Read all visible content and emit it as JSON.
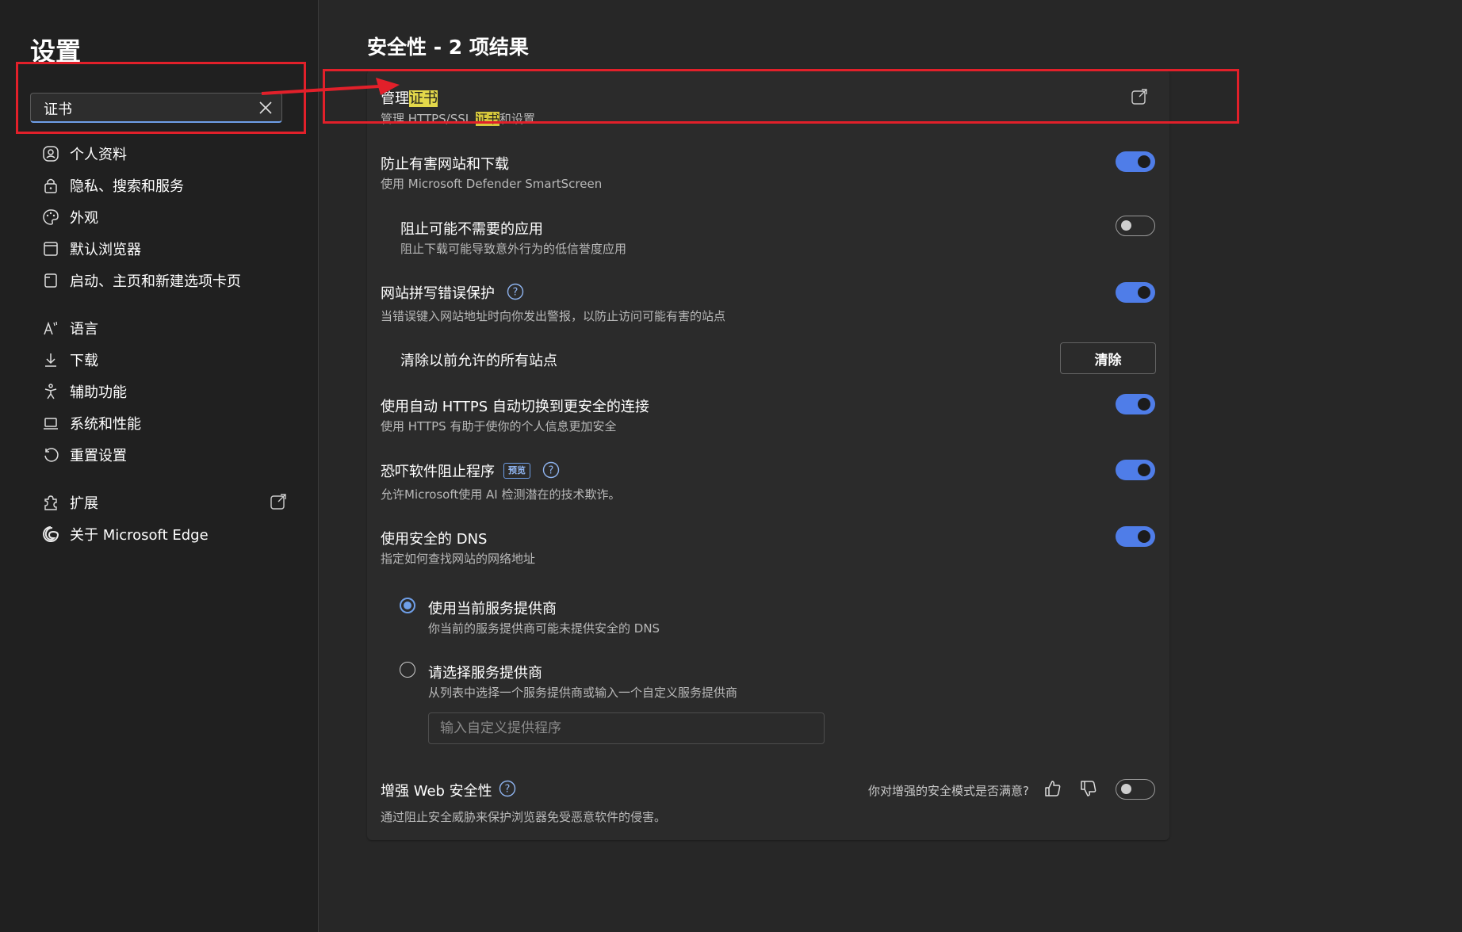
{
  "sidebar": {
    "title": "设置",
    "search": {
      "value": "证书",
      "placeholder": ""
    },
    "items": [
      {
        "label": "个人资料",
        "icon": "profile-icon"
      },
      {
        "label": "隐私、搜索和服务",
        "icon": "lock-icon"
      },
      {
        "label": "外观",
        "icon": "palette-icon"
      },
      {
        "label": "默认浏览器",
        "icon": "browser-icon"
      },
      {
        "label": "启动、主页和新建选项卡页",
        "icon": "home-page-icon"
      },
      {
        "label": "语言",
        "icon": "language-icon"
      },
      {
        "label": "下载",
        "icon": "download-icon"
      },
      {
        "label": "辅助功能",
        "icon": "accessibility-icon"
      },
      {
        "label": "系统和性能",
        "icon": "laptop-icon"
      },
      {
        "label": "重置设置",
        "icon": "reset-icon"
      },
      {
        "label": "扩展",
        "icon": "puzzle-icon"
      },
      {
        "label": "关于 Microsoft Edge",
        "icon": "edge-logo-icon"
      }
    ]
  },
  "main": {
    "title": "安全性 - 2 项结果",
    "manage_certs": {
      "title_prefix": "管理",
      "title_highlight": "证书",
      "sub_prefix": "管理 HTTPS/SSL ",
      "sub_highlight": "证书",
      "sub_suffix": "和设置"
    },
    "smartscreen": {
      "title": "防止有害网站和下载",
      "subtitle": "使用 Microsoft Defender SmartScreen",
      "on": true
    },
    "pua": {
      "title": "阻止可能不需要的应用",
      "subtitle": "阻止下载可能导致意外行为的低信誉度应用",
      "on": false
    },
    "typo": {
      "title": "网站拼写错误保护",
      "subtitle": "当错误键入网站地址时向你发出警报，以防止访问可能有害的站点",
      "on": true
    },
    "clear_sites": {
      "title": "清除以前允许的所有站点",
      "button": "清除"
    },
    "auto_https": {
      "title": "使用自动 HTTPS 自动切换到更安全的连接",
      "subtitle": "使用 HTTPS 有助于使你的个人信息更加安全",
      "on": true
    },
    "scareware": {
      "title": "恐吓软件阻止程序",
      "badge": "预览",
      "subtitle": "允许Microsoft使用 AI 检测潜在的技术欺诈。",
      "on": true
    },
    "dns": {
      "title": "使用安全的 DNS",
      "subtitle": "指定如何查找网站的网络地址",
      "on": true,
      "option1": {
        "title": "使用当前服务提供商",
        "subtitle": "你当前的服务提供商可能未提供安全的 DNS",
        "checked": true
      },
      "option2": {
        "title": "请选择服务提供商",
        "subtitle": "从列表中选择一个服务提供商或输入一个自定义服务提供商",
        "checked": false
      },
      "custom_placeholder": "输入自定义提供程序"
    },
    "web_security": {
      "title": "增强 Web 安全性",
      "subtitle": "通过阻止安全威胁来保护浏览器免受恶意软件的侵害。",
      "feedback": "你对增强的安全模式是否满意?",
      "on": false
    }
  },
  "colors": {
    "accent": "#4f7de8",
    "highlight": "#e3d84a",
    "annotation": "#e2202a"
  }
}
